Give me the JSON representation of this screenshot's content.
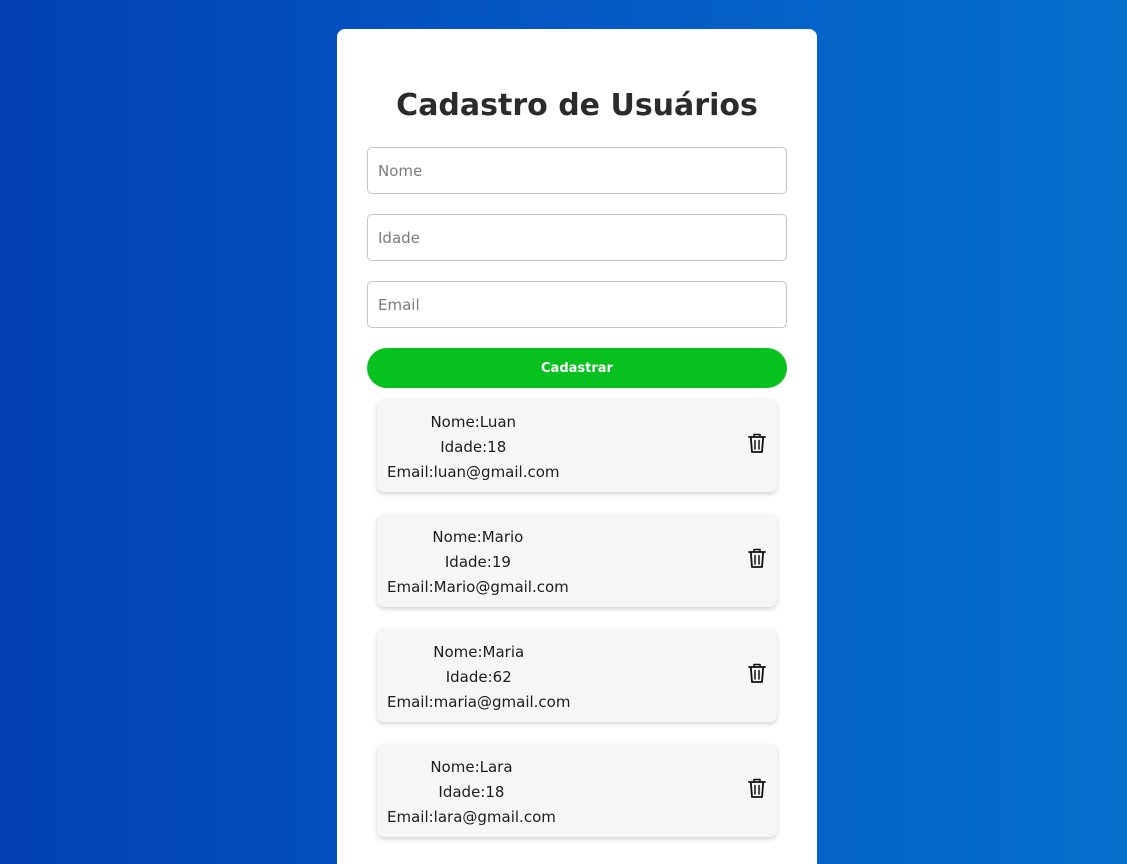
{
  "form": {
    "title": "Cadastro de Usuários",
    "name_placeholder": "Nome",
    "age_placeholder": "Idade",
    "email_placeholder": "Email",
    "submit_label": "Cadastrar"
  },
  "users": [
    {
      "name": "Nome:Luan",
      "age": "Idade:18",
      "email": "Email:luan@gmail.com",
      "delete_icon": "trash-icon"
    },
    {
      "name": "Nome:Mario",
      "age": "Idade:19",
      "email": "Email:Mario@gmail.com",
      "delete_icon": "trash-icon"
    },
    {
      "name": "Nome:Maria",
      "age": "Idade:62",
      "email": "Email:maria@gmail.com",
      "delete_icon": "trash-icon"
    },
    {
      "name": "Nome:Lara",
      "age": "Idade:18",
      "email": "Email:lara@gmail.com",
      "delete_icon": "trash-icon"
    }
  ],
  "colors": {
    "background_start": "#0340b4",
    "background_end": "#0470cc",
    "submit_button": "#07c11f",
    "card": "#ffffff",
    "user_card": "#f6f6f6"
  }
}
